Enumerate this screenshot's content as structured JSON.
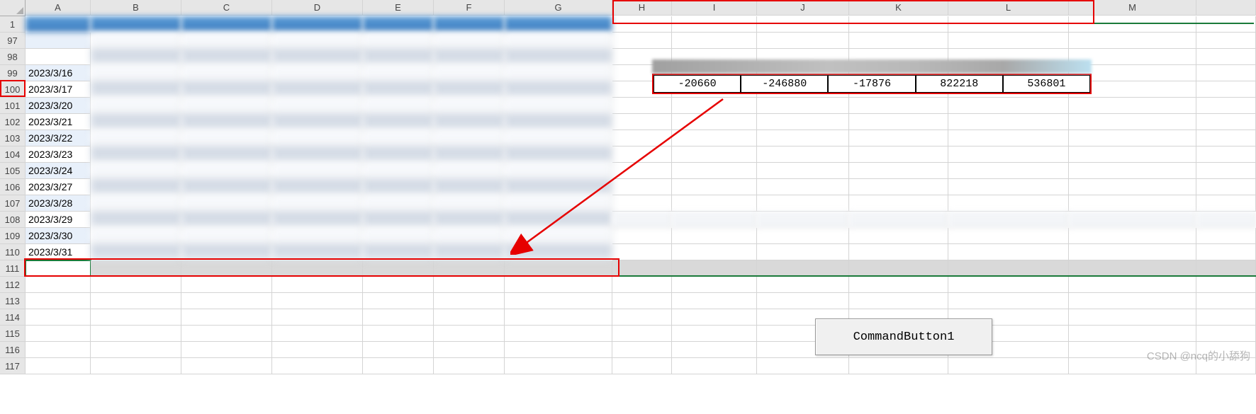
{
  "columns": [
    "A",
    "B",
    "C",
    "D",
    "E",
    "F",
    "G",
    "H",
    "I",
    "J",
    "K",
    "L",
    "M",
    ""
  ],
  "visible_rows": [
    "1",
    "97",
    "98",
    "99",
    "100",
    "101",
    "102",
    "103",
    "104",
    "105",
    "106",
    "107",
    "108",
    "109",
    "110",
    "111",
    "112",
    "113",
    "114",
    "115",
    "116",
    "117"
  ],
  "dates": {
    "99": "2023/3/16",
    "100": "2023/3/17",
    "101": "2023/3/20",
    "102": "2023/3/21",
    "103": "2023/3/22",
    "104": "2023/3/23",
    "105": "2023/3/24",
    "106": "2023/3/27",
    "107": "2023/3/28",
    "108": "2023/3/29",
    "109": "2023/3/30",
    "110": "2023/3/31"
  },
  "callout_values": [
    "-20660",
    "-246880",
    "-17876",
    "822218",
    "536801"
  ],
  "button_label": "CommandButton1",
  "watermark": "CSDN @ncq的小舔狗",
  "highlight_row": "100",
  "highlight_cols": [
    "H",
    "I",
    "J",
    "K",
    "L",
    "M"
  ]
}
